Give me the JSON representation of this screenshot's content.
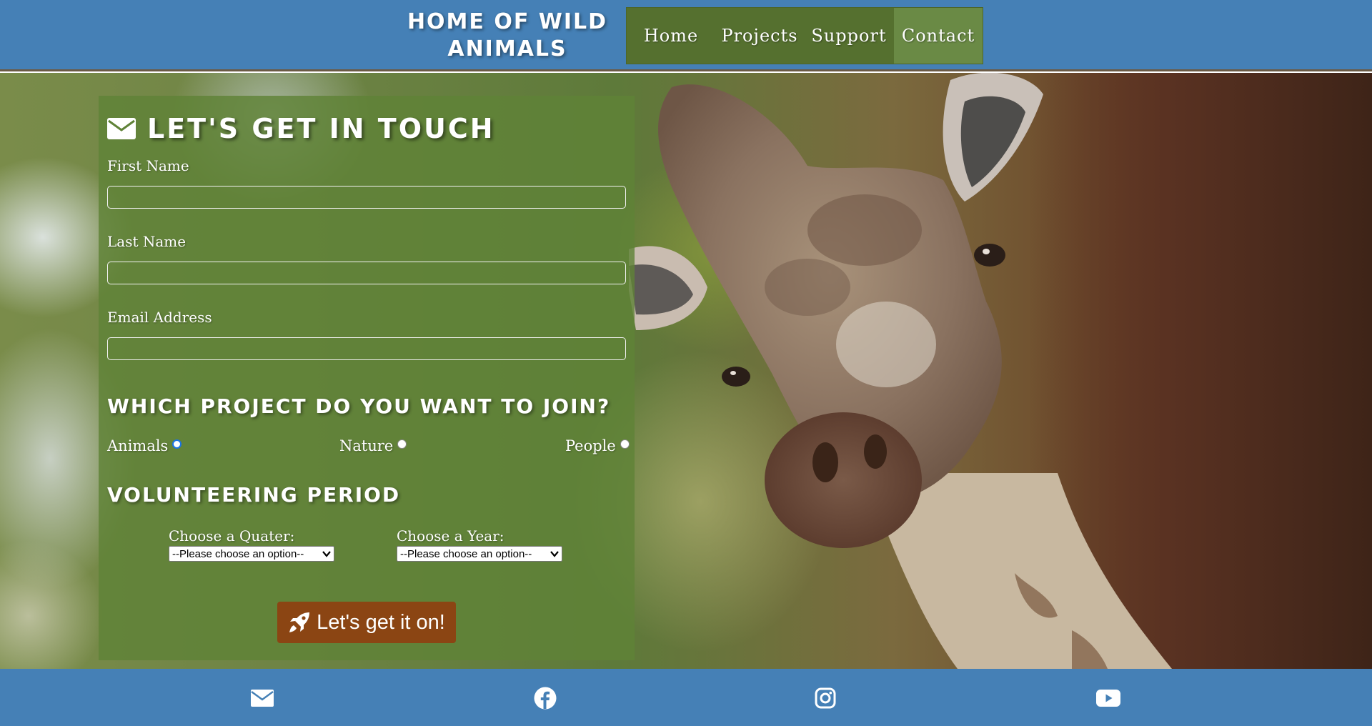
{
  "header": {
    "site_title": "HOME OF WILD ANIMALS",
    "nav": [
      {
        "label": "Home"
      },
      {
        "label": "Projects"
      },
      {
        "label": "Support"
      },
      {
        "label": "Contact",
        "active": true
      }
    ]
  },
  "form": {
    "heading": "LET'S GET IN TOUCH",
    "heading_icon": "envelope-icon",
    "first_name": {
      "label": "First Name",
      "value": ""
    },
    "last_name": {
      "label": "Last Name",
      "value": ""
    },
    "email": {
      "label": "Email Address",
      "value": ""
    },
    "project_heading": "WHICH PROJECT DO YOU WANT TO JOIN?",
    "projects": [
      {
        "label": "Animals",
        "checked": true
      },
      {
        "label": "Nature",
        "checked": false
      },
      {
        "label": "People",
        "checked": false
      }
    ],
    "period_heading": "VOLUNTEERING PERIOD",
    "quarter": {
      "label": "Choose a Quater:",
      "selected": "--Please choose an option--"
    },
    "year": {
      "label": "Choose a Year:",
      "selected": "--Please choose an option--"
    },
    "submit_label": "Let's get it on!",
    "submit_icon": "rocket-icon"
  },
  "footer": {
    "icons": [
      "envelope-icon",
      "facebook-icon",
      "instagram-icon",
      "youtube-icon"
    ]
  },
  "colors": {
    "header_bg": "#4580b6",
    "nav_bg": "#55702f",
    "nav_active_bg": "#6a8a45",
    "form_panel_bg": "#5f8237",
    "submit_bg": "#8b4513"
  }
}
